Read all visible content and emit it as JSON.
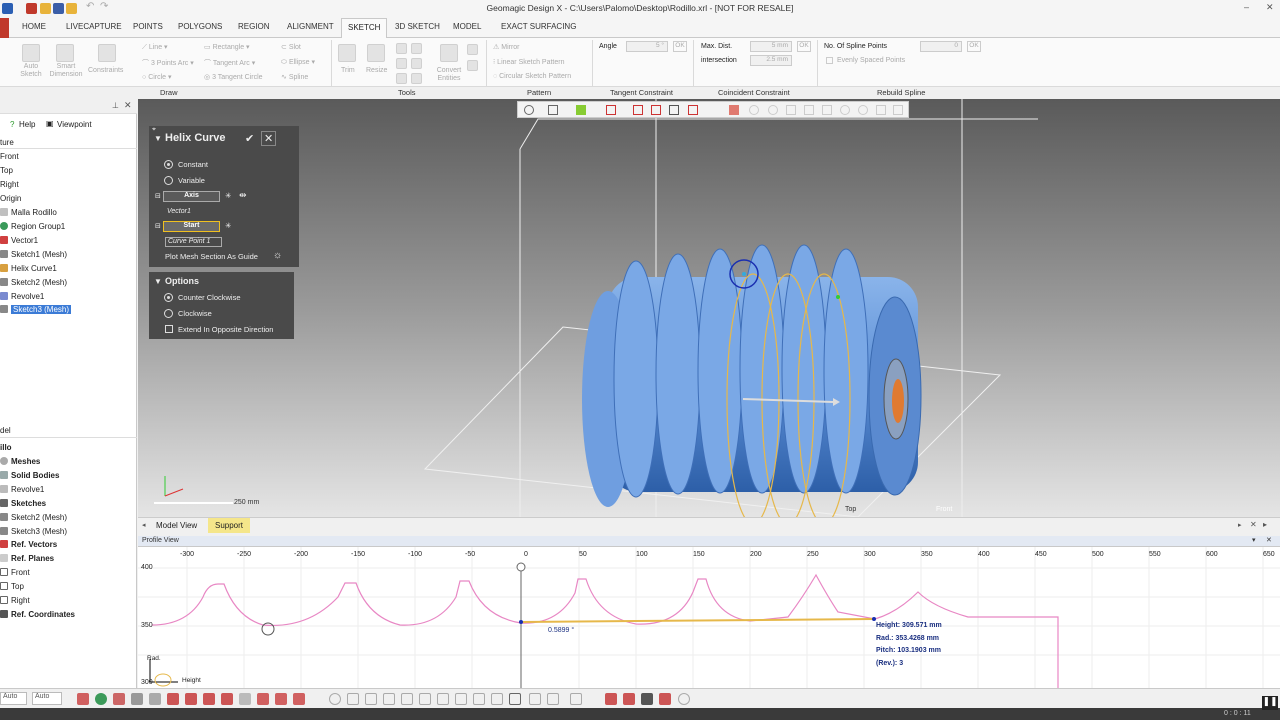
{
  "app": {
    "title": "Geomagic Design X - C:\\Users\\Palomo\\Desktop\\Rodillo.xrl - [NOT FOR RESALE]"
  },
  "ribbon_tabs": [
    "HOME",
    "LIVECAPTURE",
    "POINTS",
    "POLYGONS",
    "REGION",
    "ALIGNMENT",
    "SKETCH",
    "3D SKETCH",
    "MODEL",
    "EXACT SURFACING"
  ],
  "ribbon": {
    "draw": {
      "auto_sketch": [
        "Auto",
        "Sketch"
      ],
      "smart_dimension": [
        "Smart",
        "Dimension"
      ],
      "constraints": "Constraints",
      "line": "Line",
      "three_points_arc": "3 Points Arc",
      "circle": "Circle",
      "rectangle": "Rectangle",
      "tangent_arc": "Tangent Arc",
      "three_tangent_circle": "3 Tangent Circle",
      "slot": "Slot",
      "ellipse": "Ellipse",
      "spline": "Spline"
    },
    "tools": {
      "trim": "Trim",
      "resize": "Resize",
      "convert_entities": [
        "Convert",
        "Entities"
      ]
    },
    "pattern": {
      "mirror": "Mirror",
      "linear": "Linear Sketch Pattern",
      "circular": "Circular Sketch Pattern"
    },
    "tangent": {
      "angle_label": "Angle",
      "angle_value": "5 °",
      "ok": "OK"
    },
    "coincident": {
      "label1": "Max. Dist.",
      "label2": "intersection",
      "dist_value": "5 mm",
      "int_value": "2.5 mm",
      "ok": "OK"
    },
    "rebuild": {
      "label": "No. Of Spline Points",
      "value": "0",
      "ok": "OK",
      "evenly": "Evenly Spaced Points"
    },
    "groups": [
      "Draw",
      "Tools",
      "Pattern",
      "Tangent Constraint",
      "Coincident Constraint",
      "Rebuild Spline"
    ]
  },
  "left_panel": {
    "menu": {
      "help": "Help",
      "viewpoint": "Viewpoint"
    },
    "feature_header": "ture",
    "features": [
      "Front",
      "Top",
      "Right",
      "Origin",
      "Malla Rodillo",
      "Region Group1",
      "Vector1",
      "Sketch1 (Mesh)",
      "Helix Curve1",
      "Sketch2 (Mesh)",
      "Revolve1",
      "Sketch3 (Mesh)"
    ],
    "model_header": "del",
    "model_root": "illo",
    "model_tree": [
      "Meshes",
      "Solid Bodies",
      "Revolve1",
      "Sketches",
      "Sketch2 (Mesh)",
      "Sketch3 (Mesh)",
      "Ref. Vectors",
      "Ref. Planes",
      "Front",
      "Top",
      "Right",
      "Ref. Coordinates"
    ]
  },
  "helix_panel": {
    "title": "Helix Curve",
    "constant": "Constant",
    "variable": "Variable",
    "axis_label": "Axis",
    "axis_value": "Vector1",
    "start_label": "Start",
    "start_value": "Curve Point 1",
    "plot_mesh": "Plot Mesh Section As Guide"
  },
  "options_panel": {
    "title": "Options",
    "ccw": "Counter Clockwise",
    "cw": "Clockwise",
    "extend": "Extend In Opposite Direction"
  },
  "viewport": {
    "scale": "250 mm",
    "label_top": "Top",
    "label_front": "Front"
  },
  "view_tabs": [
    "Model View",
    "Support"
  ],
  "profile": {
    "header": "Profile View",
    "x_ticks": [
      "-300",
      "-250",
      "-200",
      "-150",
      "-100",
      "-50",
      "0",
      "50",
      "100",
      "150",
      "200",
      "250",
      "300",
      "350",
      "400",
      "450",
      "500",
      "550",
      "600",
      "650"
    ],
    "y_ticks": [
      "400",
      "350",
      "300"
    ],
    "angle": "0.5899 °",
    "height": "Height:  309.571 mm",
    "radius": "Rad.:  353.4268 mm",
    "pitch": "Pitch:  103.1903 mm",
    "rev": "(Rev.):  3",
    "axis_rad": "Rad.",
    "axis_height": "Height"
  },
  "bottom_bar": {
    "combo1": "Auto",
    "combo2": "Auto"
  },
  "status": {
    "time": "0 : 0 : 11"
  },
  "colors": {
    "accent": "#3b7bd6",
    "profile_curve": "#e887c4",
    "helix": "#e6b84a",
    "body": "#6b9ee0"
  }
}
